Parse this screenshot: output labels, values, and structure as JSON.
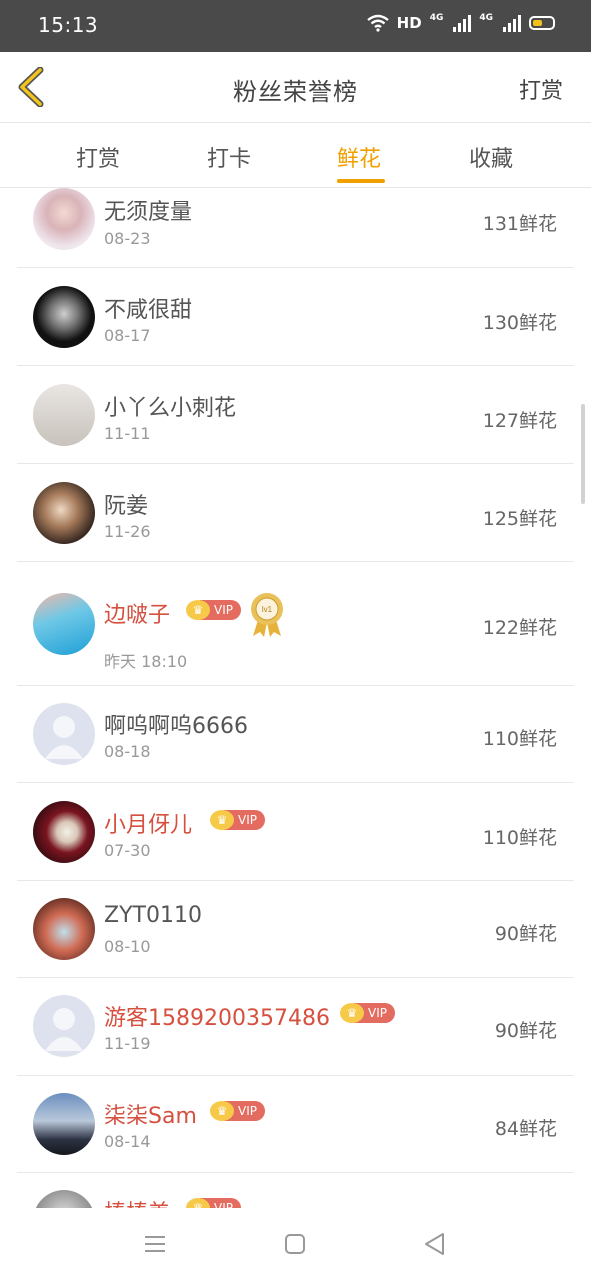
{
  "status_bar": {
    "time": "15:13",
    "hd": "HD",
    "net1": "4G",
    "net2": "4G"
  },
  "header": {
    "title": "粉丝荣誉榜",
    "action_label": "打赏"
  },
  "tabs": [
    {
      "label": "打赏",
      "active": false
    },
    {
      "label": "打卡",
      "active": false
    },
    {
      "label": "鲜花",
      "active": true
    },
    {
      "label": "收藏",
      "active": false
    }
  ],
  "rows": [
    {
      "name": "无须度量",
      "date": "08-23",
      "count": "131鲜花",
      "vip": false
    },
    {
      "name": "不咸很甜",
      "date": "08-17",
      "count": "130鲜花",
      "vip": false
    },
    {
      "name": "小丫么小刺花",
      "date": "11-11",
      "count": "127鲜花",
      "vip": false
    },
    {
      "name": "阮姜",
      "date": "11-26",
      "count": "125鲜花",
      "vip": false
    },
    {
      "name": "边啵子",
      "date": "昨天 18:10",
      "count": "122鲜花",
      "vip": true,
      "vip_label": "VIP",
      "medal": "lv1"
    },
    {
      "name": "啊呜啊呜6666",
      "date": "08-18",
      "count": "110鲜花",
      "vip": false
    },
    {
      "name": "小月伢儿",
      "date": "07-30",
      "count": "110鲜花",
      "vip": true,
      "vip_label": "VIP"
    },
    {
      "name": "ZYT0110",
      "date": "08-10",
      "count": "90鲜花",
      "vip": false
    },
    {
      "name": "游客1589200357486",
      "date": "11-19",
      "count": "90鲜花",
      "vip": true,
      "vip_label": "VIP"
    },
    {
      "name": "柒柒Sam",
      "date": "08-14",
      "count": "84鲜花",
      "vip": true,
      "vip_label": "VIP"
    },
    {
      "name": "棒棒美",
      "date": "",
      "count": "",
      "vip": true,
      "vip_label": "VIP"
    }
  ],
  "colors": {
    "accent": "#f0a000",
    "vip_name": "#d5503f",
    "status_bar": "#4a4a4a"
  },
  "icons": {
    "back": "chevron-left-icon",
    "menu": "menu-icon",
    "home": "home-square-icon",
    "back_nav": "back-triangle-icon"
  }
}
